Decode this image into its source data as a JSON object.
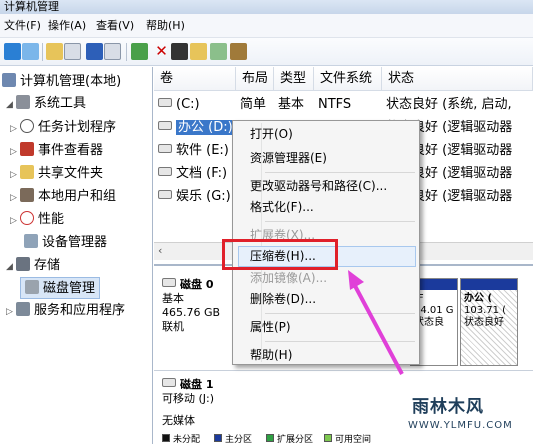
{
  "window": {
    "title": "计算机管理"
  },
  "menu": [
    "文件(F)",
    "操作(A)",
    "查看(V)",
    "帮助(H)"
  ],
  "tree": {
    "root": "计算机管理(本地)",
    "system_tools": "系统工具",
    "task_scheduler": "任务计划程序",
    "event_viewer": "事件查看器",
    "shared_folders": "共享文件夹",
    "local_users": "本地用户和组",
    "performance": "性能",
    "device_manager": "设备管理器",
    "storage": "存储",
    "disk_management": "磁盘管理",
    "services_apps": "服务和应用程序"
  },
  "volumes": {
    "headers": [
      "卷",
      "布局",
      "类型",
      "文件系统",
      "状态"
    ],
    "rows": [
      {
        "name": "(C:)",
        "layout": "简单",
        "type": "基本",
        "fs": "NTFS",
        "status": "状态良好 (系统, 启动,"
      },
      {
        "name": "办公 (D:)",
        "layout": "",
        "type": "",
        "fs": "",
        "status": "状态良好 (逻辑驱动器"
      },
      {
        "name": "软件 (E:)",
        "layout": "",
        "type": "",
        "fs": "",
        "status": "状态良好 (逻辑驱动器"
      },
      {
        "name": "文档 (F:)",
        "layout": "",
        "type": "",
        "fs": "",
        "status": "状态良好 (逻辑驱动器"
      },
      {
        "name": "娱乐 (G:)",
        "layout": "",
        "type": "",
        "fs": "",
        "status": "状态良好 (逻辑驱动器"
      }
    ]
  },
  "disk0": {
    "label": "磁盘 0",
    "type": "基本",
    "size": "465.76 GB",
    "state": "联机",
    "partitions": [
      {
        "title": "(F",
        "size": "04.01 G",
        "status": "状态良"
      },
      {
        "title": "办公 (",
        "size": "103.71 (",
        "status": "状态良好"
      }
    ]
  },
  "disk1": {
    "label": "磁盘 1",
    "type": "可移动 (J:)",
    "media": "无媒体"
  },
  "legend": [
    "未分配",
    "主分区",
    "扩展分区",
    "可用空间"
  ],
  "context_menu": {
    "items": [
      {
        "label": "打开(O)",
        "disabled": false
      },
      {
        "label": "资源管理器(E)",
        "disabled": false
      },
      {
        "label": "更改驱动器号和路径(C)...",
        "disabled": false
      },
      {
        "label": "格式化(F)...",
        "disabled": false
      },
      {
        "label": "扩展卷(X)...",
        "disabled": true
      },
      {
        "label": "压缩卷(H)...",
        "disabled": false,
        "highlighted": true
      },
      {
        "label": "添加镜像(A)...",
        "disabled": true
      },
      {
        "label": "删除卷(D)...",
        "disabled": false
      },
      {
        "label": "属性(P)",
        "disabled": false
      },
      {
        "label": "帮助(H)",
        "disabled": false
      }
    ]
  },
  "watermark": {
    "brand": "雨林木风",
    "url": "WWW.YLMFU.COM"
  },
  "colors": {
    "highlight_box": "#e0202a",
    "arrow": "#e040d8",
    "primary_partition": "#1b3a9c"
  }
}
